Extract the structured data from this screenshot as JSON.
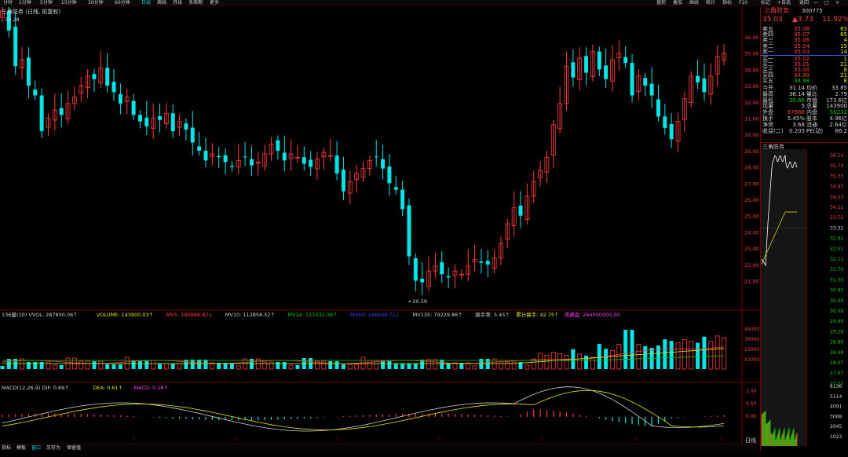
{
  "topbar": {
    "items": [
      "分时",
      "1分钟",
      "5分钟",
      "15分钟",
      "30分钟",
      "60分钟",
      "日线",
      "周线",
      "月线",
      "多周期",
      "更多"
    ],
    "right": [
      "盘前",
      "叠加",
      "画线",
      "统计",
      "指标",
      "F10",
      "标记",
      "+自选",
      "返回"
    ]
  },
  "stock": {
    "name": "三角防务",
    "code": "300775",
    "title": "三角防务 (日线, 前复权)",
    "last": "35.03",
    "change": "▲3.73",
    "pct": "11.92%"
  },
  "kline": {
    "price_labels": [
      "36.00",
      "35.00",
      "34.00",
      "33.00",
      "32.00",
      "31.00",
      "30.00",
      "29.00",
      "28.00",
      "27.00",
      "26.00",
      "25.00",
      "24.00",
      "23.00",
      "22.00",
      "21.00"
    ],
    "high_label": "39.28",
    "low_label": "←20.59",
    "colors": {
      "up": "#ff3c3c",
      "down": "#00e6e6"
    }
  },
  "volume": {
    "header": [
      {
        "t": "136量(10) VVOL: 287800.06↑",
        "c": "#d0d0d0"
      },
      {
        "t": "VOLUME: 143900.03↑",
        "c": "#e8e800"
      },
      {
        "t": "MV5: 180888.82↓",
        "c": "#ff3c3c"
      },
      {
        "t": "MV10: 112858.52↑",
        "c": "#d0d0d0"
      },
      {
        "t": "MV24: 111432.38↑",
        "c": "#00c800"
      },
      {
        "t": "MV60: 166638.71↓",
        "c": "#4040ff"
      },
      {
        "t": "MV135: 79229.86↑",
        "c": "#d0d0d0"
      },
      {
        "t": "换手率: 5.45↑",
        "c": "#d0d0d0"
      },
      {
        "t": "累计换手: 42.75↑",
        "c": "#e8e800"
      },
      {
        "t": "流通盘: 264000000.00",
        "c": "#ff40ff"
      }
    ],
    "labels": [
      "45000",
      "30000",
      "15000",
      "X1000"
    ]
  },
  "macd": {
    "header": [
      {
        "t": "MACD(12,26,9) DIF: 0.69↑",
        "c": "#d0d0d0"
      },
      {
        "t": "DEA: 0.61↑",
        "c": "#e8e800"
      },
      {
        "t": "MACD: 0.16↑",
        "c": "#ff40ff"
      }
    ],
    "labels": [
      "1.00",
      "0.50",
      "0.00"
    ]
  },
  "orderbook": {
    "asks": [
      [
        "卖五",
        "35.08",
        "63"
      ],
      [
        "卖四",
        "35.07",
        "65"
      ],
      [
        "卖三",
        "35.06",
        "4"
      ],
      [
        "卖二",
        "35.04",
        "15"
      ],
      [
        "卖一",
        "35.03",
        "14"
      ]
    ],
    "bids": [
      [
        "买一",
        "35.02",
        "1"
      ],
      [
        "买二",
        "35.01",
        "21"
      ],
      [
        "买三",
        "35.00",
        "8"
      ],
      [
        "买四",
        "34.99",
        "21"
      ],
      [
        "买五",
        "34.98",
        "8"
      ]
    ]
  },
  "stats": [
    [
      "今开",
      "31.14",
      "均价",
      "33.85"
    ],
    [
      "最高",
      "36.14",
      "量比",
      "2.79"
    ],
    [
      "最低",
      "30.66",
      "市值",
      "173.6亿"
    ],
    [
      "现量",
      "5",
      "总量",
      "143900"
    ],
    [
      "外盘",
      "87668",
      "内盘",
      "56232"
    ],
    [
      "换手",
      "5.45%",
      "股本",
      "4.96亿"
    ],
    [
      "净资",
      "3.68",
      "流通",
      "2.64亿"
    ],
    [
      "收益(二)",
      "0.203",
      "PE(动)",
      "86.2"
    ]
  ],
  "mini": {
    "name": "三角防务",
    "price_labels": [
      "36.14",
      "35.74",
      "35.33",
      "34.93",
      "34.53",
      "34.12",
      "33.72",
      "33.32",
      "32.91",
      "32.51",
      "32.11",
      "31.70",
      "31.30",
      "30.90",
      "30.49",
      "30.09",
      "29.69",
      "29.28",
      "28.88",
      "28.48",
      "28.07",
      "27.67",
      "27.27"
    ],
    "vol_labels": [
      "6136",
      "5114",
      "4091",
      "3068",
      "2045",
      "1023"
    ],
    "tab": "日线"
  },
  "bottombar": [
    "指标",
    "模板",
    "窗口",
    "另存为",
    "保留值"
  ]
}
